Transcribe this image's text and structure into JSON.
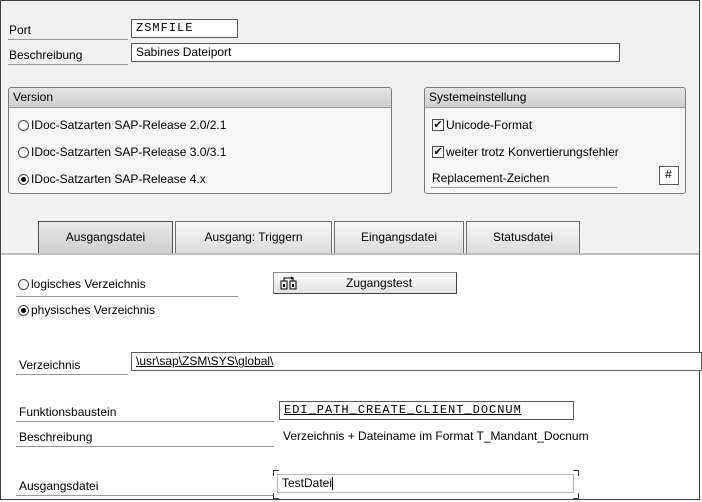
{
  "header": {
    "port_label": "Port",
    "port_value": "ZSMFILE",
    "description_label": "Beschreibung",
    "description_value": "Sabines Dateiport"
  },
  "version_group": {
    "title": "Version",
    "options": [
      {
        "label": "IDoc-Satzarten SAP-Release 2.0/2.1",
        "selected": false
      },
      {
        "label": "IDoc-Satzarten SAP-Release 3.0/3.1",
        "selected": false
      },
      {
        "label": "IDoc-Satzarten SAP-Release 4.x",
        "selected": true
      }
    ]
  },
  "system_group": {
    "title": "Systemeinstellung",
    "unicode_label": "Unicode-Format",
    "unicode_checked": true,
    "continue_label": "weiter trotz Konvertierungsfehler",
    "continue_checked": true,
    "replacement_label": "Replacement-Zeichen",
    "replacement_value": "#"
  },
  "tabs": [
    {
      "label": "Ausgangsdatei",
      "active": true
    },
    {
      "label": "Ausgang: Triggern",
      "active": false
    },
    {
      "label": "Eingangsdatei",
      "active": false
    },
    {
      "label": "Statusdatei",
      "active": false
    }
  ],
  "directory_type": {
    "logical_label": "logisches Verzeichnis",
    "physical_label": "physisches Verzeichnis",
    "selected": "physical"
  },
  "access_test": {
    "label": "Zugangstest",
    "icon": "access-test-icon"
  },
  "directory": {
    "label": "Verzeichnis",
    "value": "\\usr\\sap\\ZSM\\SYS\\global\\"
  },
  "function_module": {
    "label": "Funktionsbaustein",
    "value": "EDI_PATH_CREATE_CLIENT_DOCNUM"
  },
  "function_description": {
    "label": "Beschreibung",
    "value": "Verzeichnis + Dateiname im Format T_Mandant_Docnum"
  },
  "output_file": {
    "label": "Ausgangsdatei",
    "value": "TestDatei"
  }
}
